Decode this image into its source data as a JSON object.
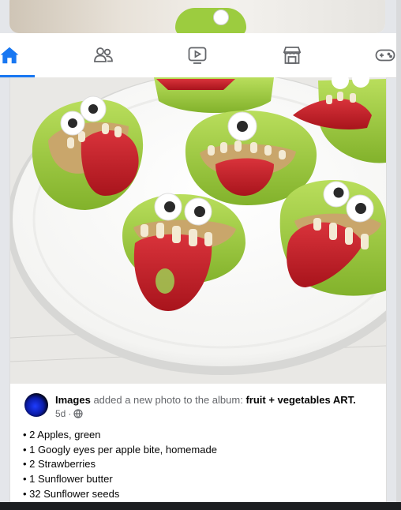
{
  "nav": {
    "tabs": [
      {
        "name": "home",
        "active": true
      },
      {
        "name": "friends",
        "active": false
      },
      {
        "name": "video",
        "active": false
      },
      {
        "name": "marketplace",
        "active": false
      },
      {
        "name": "gaming",
        "active": false
      }
    ],
    "accent_color": "#1877f2"
  },
  "post": {
    "author": "Images",
    "action_text": "added a new photo to the album:",
    "album_name": "fruit + vegetables ART.",
    "time_ago": "5d",
    "separator": "·",
    "privacy_icon": "globe-icon",
    "ingredients": [
      "2 Apples, green",
      "1 Googly eyes per apple bite, homemade",
      "2 Strawberries",
      "1 Sunflower butter",
      "32 Sunflower seeds"
    ]
  }
}
